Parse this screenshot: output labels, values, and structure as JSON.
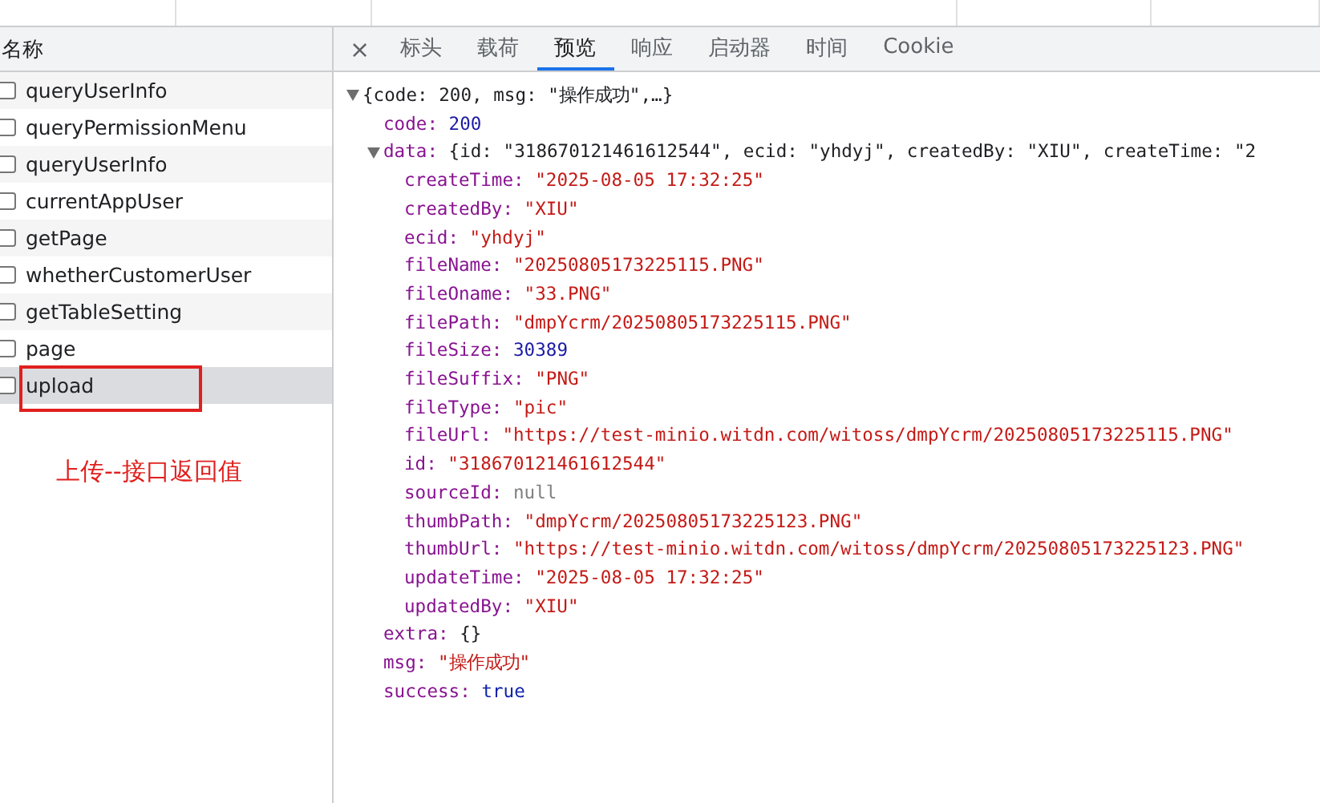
{
  "request_list": {
    "header": "名称",
    "items": [
      {
        "name": "queryUserInfo",
        "checked": false,
        "selected": false,
        "annotated": false
      },
      {
        "name": "queryPermissionMenu",
        "checked": false,
        "selected": false,
        "annotated": false
      },
      {
        "name": "queryUserInfo",
        "checked": false,
        "selected": false,
        "annotated": false
      },
      {
        "name": "currentAppUser",
        "checked": false,
        "selected": false,
        "annotated": false
      },
      {
        "name": "getPage",
        "checked": false,
        "selected": false,
        "annotated": false
      },
      {
        "name": "whetherCustomerUser",
        "checked": false,
        "selected": false,
        "annotated": false
      },
      {
        "name": "getTableSetting",
        "checked": false,
        "selected": false,
        "annotated": false
      },
      {
        "name": "page",
        "checked": false,
        "selected": false,
        "annotated": false
      },
      {
        "name": "upload",
        "checked": false,
        "selected": true,
        "annotated": true
      }
    ],
    "annotation_label": "上传--接口返回值"
  },
  "preview": {
    "close": "×",
    "tabs": [
      {
        "label": "标头",
        "selected": false
      },
      {
        "label": "载荷",
        "selected": false
      },
      {
        "label": "预览",
        "selected": true
      },
      {
        "label": "响应",
        "selected": false
      },
      {
        "label": "启动器",
        "selected": false
      },
      {
        "label": "时间",
        "selected": false
      },
      {
        "label": "Cookie",
        "selected": false
      }
    ],
    "tree": {
      "summary": "{code: 200, msg: \"操作成功\",…}",
      "expanded": true,
      "children": [
        {
          "key": "code:",
          "value": "200",
          "kind": "number"
        },
        {
          "key": "data:",
          "summary": "{id: \"318670121461612544\", ecid: \"yhdyj\", createdBy: \"XIU\", createTime: \"2",
          "kind": "object",
          "expanded": true,
          "children": [
            {
              "key": "createTime:",
              "value": "\"2025-08-05 17:32:25\"",
              "kind": "string"
            },
            {
              "key": "createdBy:",
              "value": "\"XIU\"",
              "kind": "string"
            },
            {
              "key": "ecid:",
              "value": "\"yhdyj\"",
              "kind": "string"
            },
            {
              "key": "fileName:",
              "value": "\"20250805173225115.PNG\"",
              "kind": "string"
            },
            {
              "key": "fileOname:",
              "value": "\"33.PNG\"",
              "kind": "string"
            },
            {
              "key": "filePath:",
              "value": "\"dmpYcrm/20250805173225115.PNG\"",
              "kind": "string"
            },
            {
              "key": "fileSize:",
              "value": "30389",
              "kind": "number"
            },
            {
              "key": "fileSuffix:",
              "value": "\"PNG\"",
              "kind": "string"
            },
            {
              "key": "fileType:",
              "value": "\"pic\"",
              "kind": "string"
            },
            {
              "key": "fileUrl:",
              "value": "\"https://test-minio.witdn.com/witoss/dmpYcrm/20250805173225115.PNG\"",
              "kind": "string"
            },
            {
              "key": "id:",
              "value": "\"318670121461612544\"",
              "kind": "string"
            },
            {
              "key": "sourceId:",
              "value": "null",
              "kind": "null"
            },
            {
              "key": "thumbPath:",
              "value": "\"dmpYcrm/20250805173225123.PNG\"",
              "kind": "string"
            },
            {
              "key": "thumbUrl:",
              "value": "\"https://test-minio.witdn.com/witoss/dmpYcrm/20250805173225123.PNG\"",
              "kind": "string"
            },
            {
              "key": "updateTime:",
              "value": "\"2025-08-05 17:32:25\"",
              "kind": "string"
            },
            {
              "key": "updatedBy:",
              "value": "\"XIU\"",
              "kind": "string"
            }
          ]
        },
        {
          "key": "extra:",
          "value": "{}",
          "kind": "object"
        },
        {
          "key": "msg:",
          "value": "\"操作成功\"",
          "kind": "string"
        },
        {
          "key": "success:",
          "value": "true",
          "kind": "boolean"
        }
      ]
    }
  }
}
